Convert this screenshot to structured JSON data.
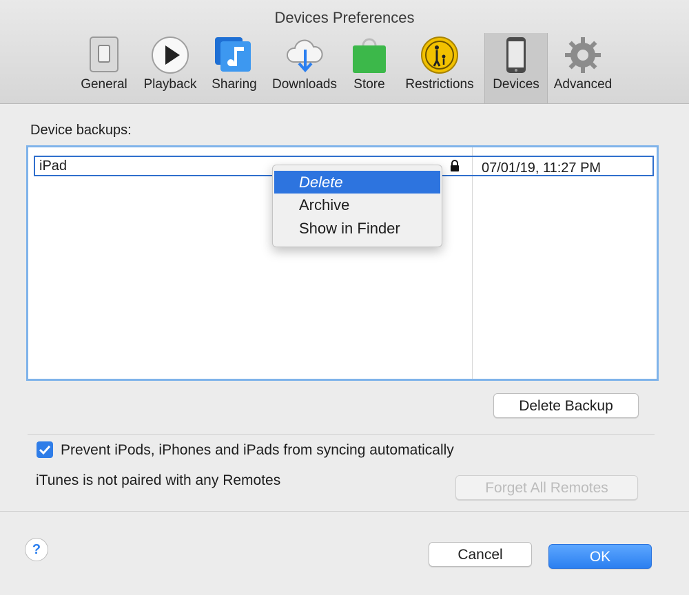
{
  "window": {
    "title": "Devices Preferences"
  },
  "toolbar": {
    "items": [
      {
        "label": "General",
        "icon": "general-switch-icon"
      },
      {
        "label": "Playback",
        "icon": "play-icon"
      },
      {
        "label": "Sharing",
        "icon": "music-note-icon"
      },
      {
        "label": "Downloads",
        "icon": "cloud-download-icon"
      },
      {
        "label": "Store",
        "icon": "shopping-bag-icon"
      },
      {
        "label": "Restrictions",
        "icon": "parental-icon"
      },
      {
        "label": "Devices",
        "icon": "phone-icon",
        "active": true
      },
      {
        "label": "Advanced",
        "icon": "gear-icon"
      }
    ]
  },
  "backups": {
    "label": "Device backups:",
    "rows": [
      {
        "name": "iPad",
        "locked": true,
        "date": "07/01/19, 11:27 PM"
      }
    ],
    "delete_button": "Delete Backup"
  },
  "context_menu": {
    "items": [
      {
        "label": "Delete",
        "highlighted": true
      },
      {
        "label": "Archive"
      },
      {
        "label": "Show in Finder"
      }
    ]
  },
  "sync": {
    "prevent_label": "Prevent iPods, iPhones and iPads from syncing automatically",
    "prevent_checked": true
  },
  "remotes": {
    "status": "iTunes is not paired with any Remotes",
    "forget_button": "Forget All Remotes"
  },
  "footer": {
    "help_label": "?",
    "cancel": "Cancel",
    "ok": "OK"
  },
  "colors": {
    "accent": "#2d74df",
    "selection_border": "#7fb3ea"
  }
}
